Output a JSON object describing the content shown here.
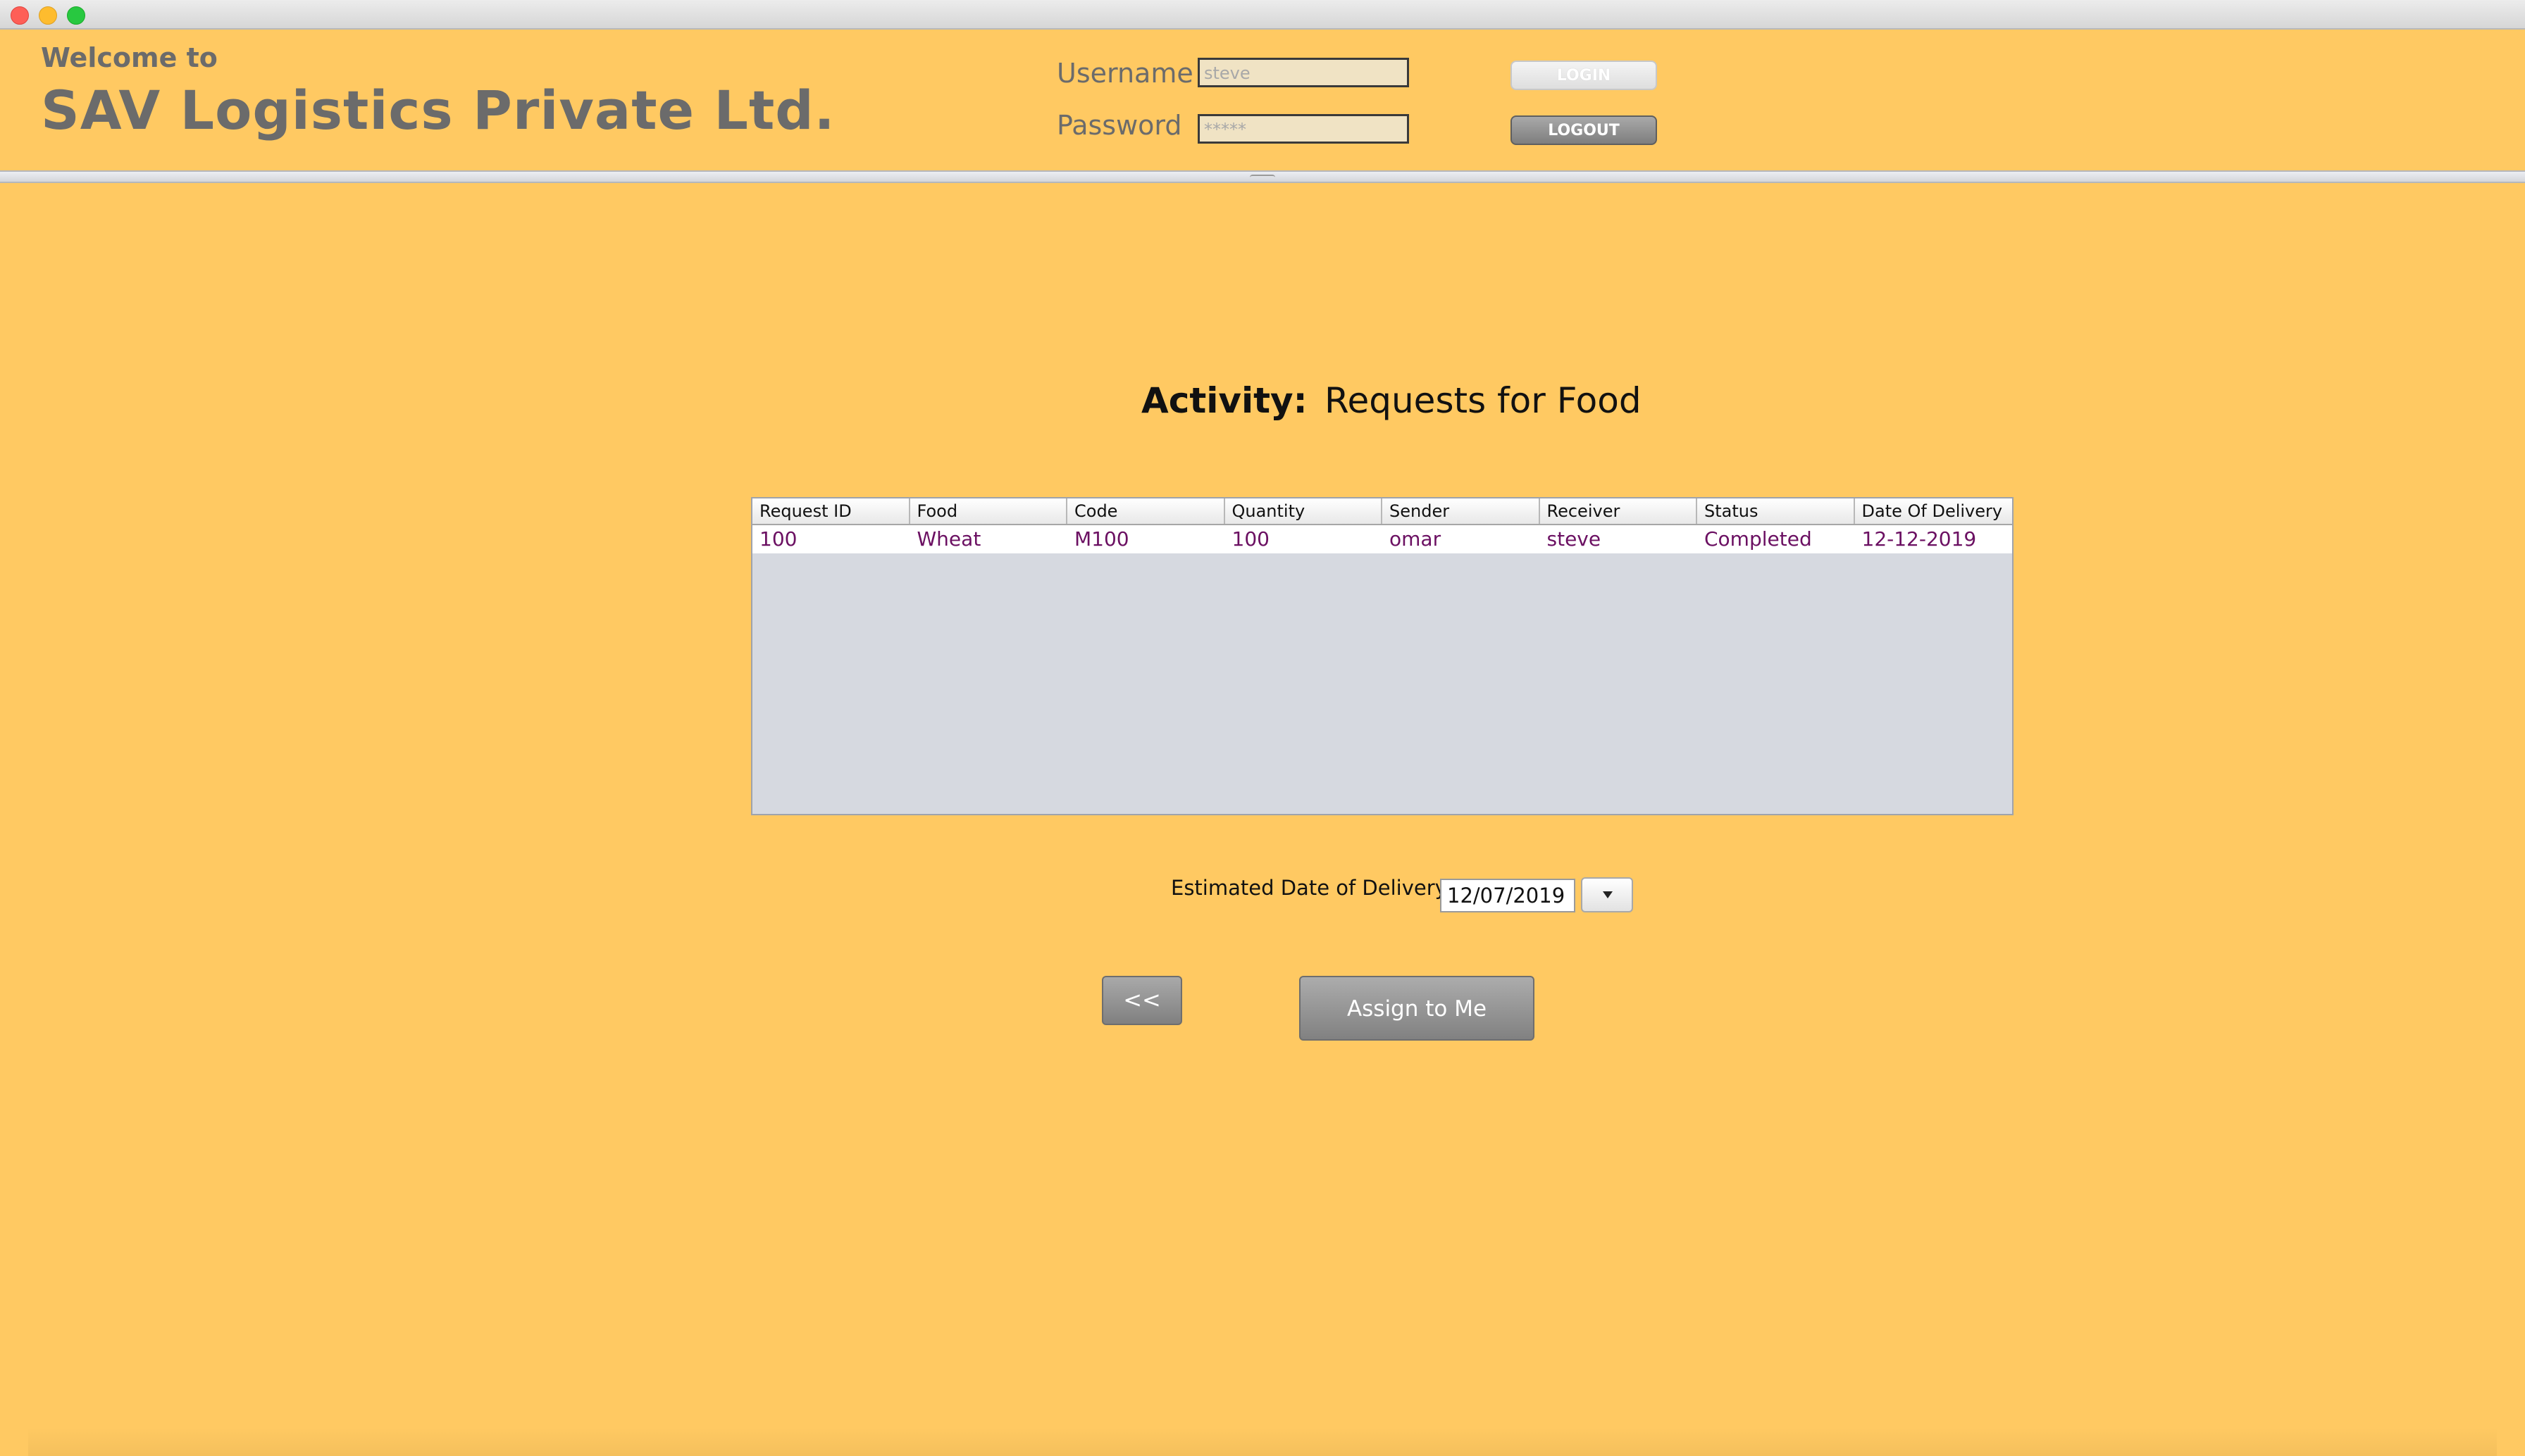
{
  "header": {
    "welcome": "Welcome to",
    "company": "SAV Logistics Private Ltd.",
    "username_label": "Username",
    "username_value": "steve",
    "password_label": "Password",
    "password_value": "*****",
    "login_label": "LOGIN",
    "logout_label": "LOGOUT"
  },
  "activity": {
    "label": "Activity:",
    "value": "Requests for Food"
  },
  "table": {
    "columns": [
      "Request ID",
      "Food",
      "Code",
      "Quantity",
      "Sender",
      "Receiver",
      "Status",
      "Date Of Delivery"
    ],
    "rows": [
      [
        "100",
        "Wheat",
        "M100",
        "100",
        "omar",
        "steve",
        "Completed",
        "12-12-2019"
      ]
    ]
  },
  "delivery": {
    "label": "Estimated Date of Delivery",
    "date": "12/07/2019"
  },
  "buttons": {
    "back": "<<",
    "assign": "Assign to Me"
  },
  "colors": {
    "background": "#ffc962",
    "table_text": "#6b1062",
    "header_text": "#6b6b6b"
  }
}
